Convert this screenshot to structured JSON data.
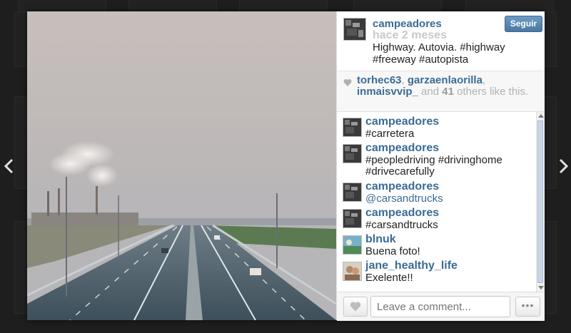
{
  "post": {
    "owner": "campeadores",
    "time_ago": "hace 2 meses",
    "caption": "Highway. Autovia. #highway #freeway #autopista",
    "follow_label": "Seguir",
    "photo_alt": "highway-photo"
  },
  "likes": {
    "users": [
      "torhec63",
      "garzaenlaorilla",
      "inmaisvvip_"
    ],
    "sep1": ", ",
    "sep2": ",",
    "and_text": " and ",
    "count": "41",
    "others_text": " others like this."
  },
  "comments": [
    {
      "user": "campeadores",
      "text": "#carretera",
      "link": false
    },
    {
      "user": "campeadores",
      "text": "#peopledriving #drivinghome #drivecarefully",
      "link": false
    },
    {
      "user": "campeadores",
      "text": "@carsandtrucks",
      "link": true
    },
    {
      "user": "campeadores",
      "text": "#carsandtrucks",
      "link": false
    },
    {
      "user": "blnuk",
      "text": "Buena foto!",
      "link": false
    },
    {
      "user": "jane_healthy_life",
      "text": "Exelente!!",
      "link": false
    }
  ],
  "compose": {
    "placeholder": "Leave a comment...",
    "more_label": "•••"
  },
  "icons": {
    "prev": "chevron-left-icon",
    "next": "chevron-right-icon",
    "heart": "heart-icon"
  },
  "colors": {
    "link": "#3b6b96",
    "follow_button": "#4a78a4"
  }
}
